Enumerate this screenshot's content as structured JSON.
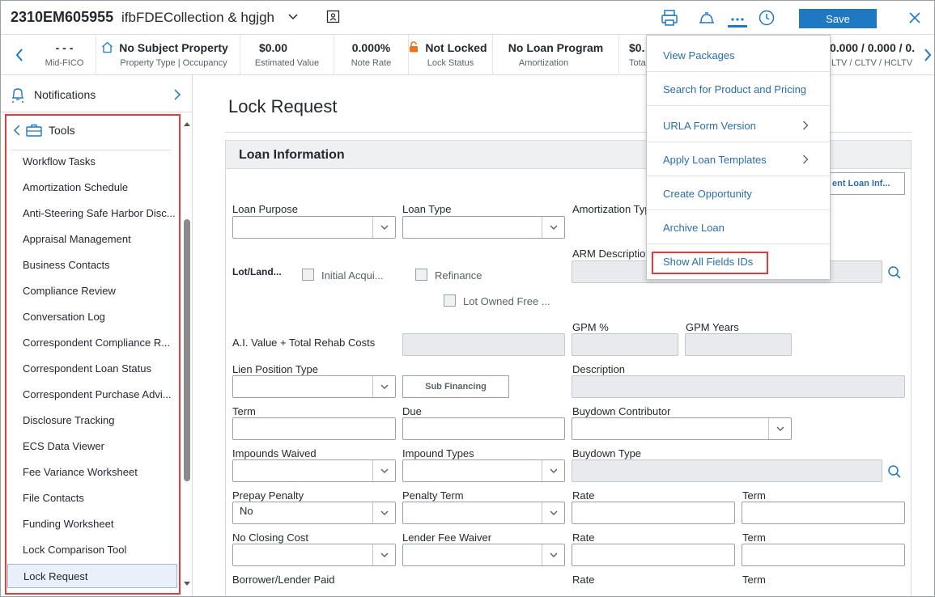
{
  "header": {
    "loan_number": "2310EM605955",
    "folder": "ifbFDECollection & hgjgh",
    "save_label": "Save"
  },
  "infobar": [
    {
      "value": "- - -",
      "label": "Mid-FICO"
    },
    {
      "value": "No Subject Property",
      "label": "Property Type | Occupancy"
    },
    {
      "value": "$0.00",
      "label": "Estimated Value"
    },
    {
      "value": "0.000%",
      "label": "Note Rate"
    },
    {
      "value": "Not Locked",
      "label": "Lock Status"
    },
    {
      "value": "No Loan Program",
      "label": "Amortization"
    },
    {
      "value": "$0.",
      "label": "Tota"
    },
    {
      "value": "0.000 / 0.000 / 0.",
      "label": "LTV / CLTV / HCLTV"
    }
  ],
  "sidebar": {
    "notifications": "Notifications",
    "tools_title": "Tools",
    "tools": [
      "Workflow Tasks",
      "Amortization Schedule",
      "Anti-Steering Safe Harbor Disc...",
      "Appraisal Management",
      "Business Contacts",
      "Compliance Review",
      "Conversation Log",
      "Correspondent Compliance R...",
      "Correspondent Loan Status",
      "Correspondent Purchase Advi...",
      "Disclosure Tracking",
      "ECS Data Viewer",
      "Fee Variance Worksheet",
      "File Contacts",
      "Funding Worksheet",
      "Lock Comparison Tool",
      "Lock Request"
    ],
    "selected": "Lock Request"
  },
  "main": {
    "page_title": "Lock Request",
    "section_title": "Loan Information",
    "cut_button": "ent Loan Inf...",
    "fields": {
      "loan_purpose": "Loan Purpose",
      "loan_type": "Loan Type",
      "amortization_type": "Amortization Typ",
      "lot_land": "Lot/Land...",
      "initial_acqui": "Initial Acqui...",
      "refinance": "Refinance",
      "arm_description": "ARM Description",
      "lot_owned_free": "Lot Owned Free ...",
      "ai_value": "A.I. Value + Total Rehab Costs",
      "gpm_pct": "GPM %",
      "gpm_years": "GPM Years",
      "lien_position_type": "Lien Position Type",
      "sub_financing": "Sub Financing",
      "description": "Description",
      "term": "Term",
      "due": "Due",
      "buydown_contributor": "Buydown Contributor",
      "impounds_waived": "Impounds Waived",
      "impound_types": "Impound Types",
      "buydown_type": "Buydown Type",
      "prepay_penalty": "Prepay Penalty",
      "prepay_penalty_value": "No",
      "penalty_term": "Penalty Term",
      "rate": "Rate",
      "term2": "Term",
      "no_closing_cost": "No Closing Cost",
      "lender_fee_waiver": "Lender Fee Waiver",
      "rate2": "Rate",
      "term3": "Term",
      "borrower_lender_paid": "Borrower/Lender Paid",
      "rate3": "Rate",
      "term4": "Term"
    }
  },
  "menu": {
    "items": [
      {
        "label": "View Packages",
        "submenu": false
      },
      {
        "label": "Search for Product and Pricing",
        "submenu": false
      },
      {
        "label": "URLA Form Version",
        "submenu": true
      },
      {
        "label": "Apply Loan Templates",
        "submenu": true
      },
      {
        "label": "Create Opportunity",
        "submenu": false
      },
      {
        "label": "Archive Loan",
        "submenu": false
      },
      {
        "label": "Show All Fields IDs",
        "submenu": false
      }
    ]
  },
  "colors": {
    "accent": "#1e79c2",
    "highlight": "#e43a3a",
    "link": "#2b6ea8"
  }
}
